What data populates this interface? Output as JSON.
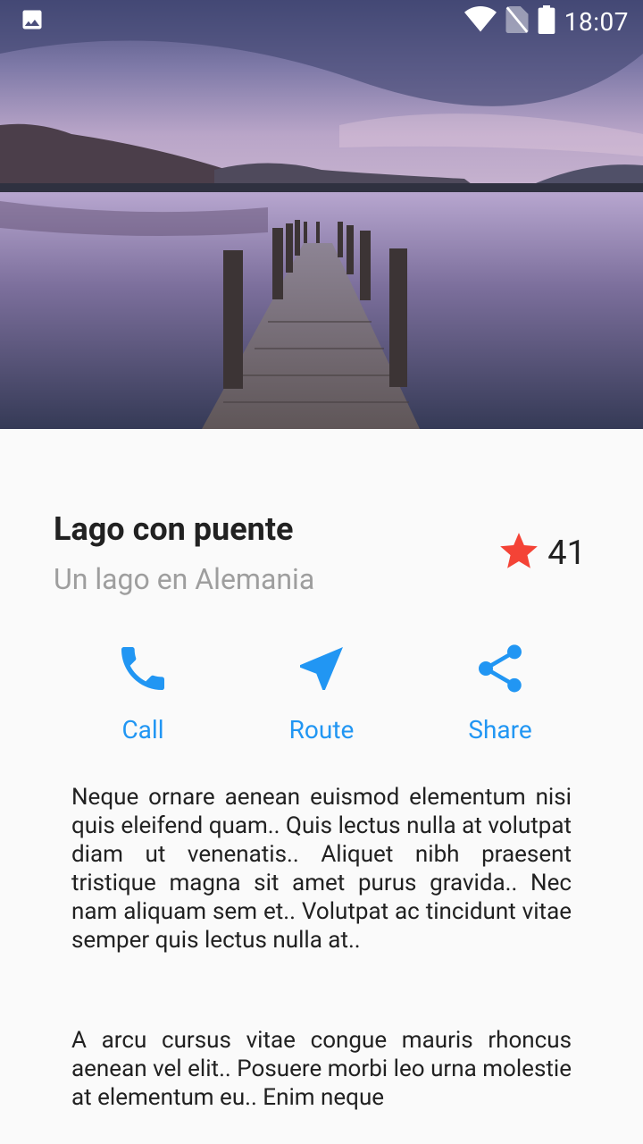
{
  "status_bar": {
    "time": "18:07",
    "icons": [
      "image-notification-icon",
      "wifi-icon",
      "no-sim-icon",
      "battery-icon"
    ]
  },
  "hero": {
    "image_subject": "lake-with-wooden-pier"
  },
  "place": {
    "title": "Lago con puente",
    "subtitle": "Un lago en Alemania"
  },
  "rating": {
    "icon": "star-icon",
    "count": "41",
    "star_color": "#f44336"
  },
  "actions": [
    {
      "label": "Call",
      "icon": "phone-icon"
    },
    {
      "label": "Route",
      "icon": "navigation-icon"
    },
    {
      "label": "Share",
      "icon": "share-icon"
    }
  ],
  "accent_color": "#2196f3",
  "description": {
    "paragraphs": [
      "Neque ornare aenean euismod elementum nisi quis eleifend quam.. Quis lectus nulla at volutpat diam ut venenatis.. Aliquet nibh praesent tristique magna sit amet purus gravida.. Nec nam aliquam sem et.. Volutpat ac tincidunt vitae semper quis lectus nulla at..",
      "A arcu cursus vitae congue mauris rhoncus aenean vel elit.. Posuere morbi leo urna molestie at elementum eu.. Enim neque"
    ]
  }
}
